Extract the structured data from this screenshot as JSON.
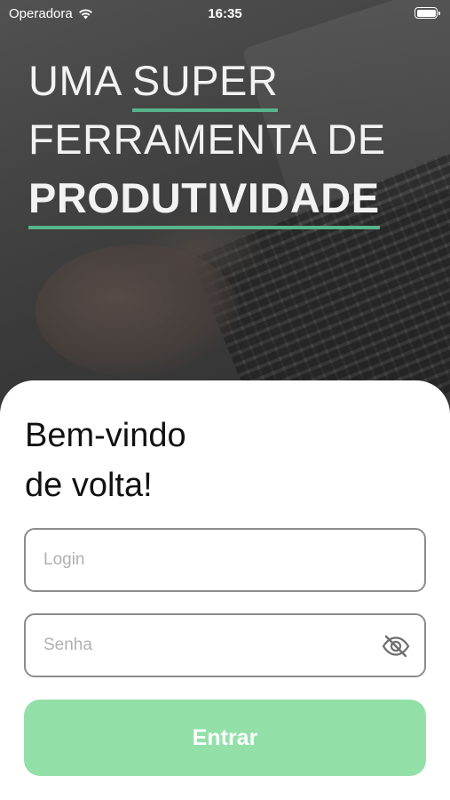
{
  "status_bar": {
    "carrier": "Operadora",
    "time": "16:35",
    "wifi_icon": "wifi-icon",
    "battery_icon": "battery-icon"
  },
  "hero": {
    "line1_part1": "UMA ",
    "line1_part2": "SUPER",
    "line2": "FERRAMENTA DE",
    "line3": "PRODUTIVIDADE",
    "accent_color": "#58b48a"
  },
  "welcome": {
    "line1": "Bem-vindo",
    "line2": "de volta!"
  },
  "form": {
    "login": {
      "placeholder": "Login",
      "value": ""
    },
    "password": {
      "placeholder": "Senha",
      "value": "",
      "toggle_icon": "eye-slash-icon"
    },
    "submit_label": "Entrar",
    "submit_color": "#92e0a8"
  }
}
